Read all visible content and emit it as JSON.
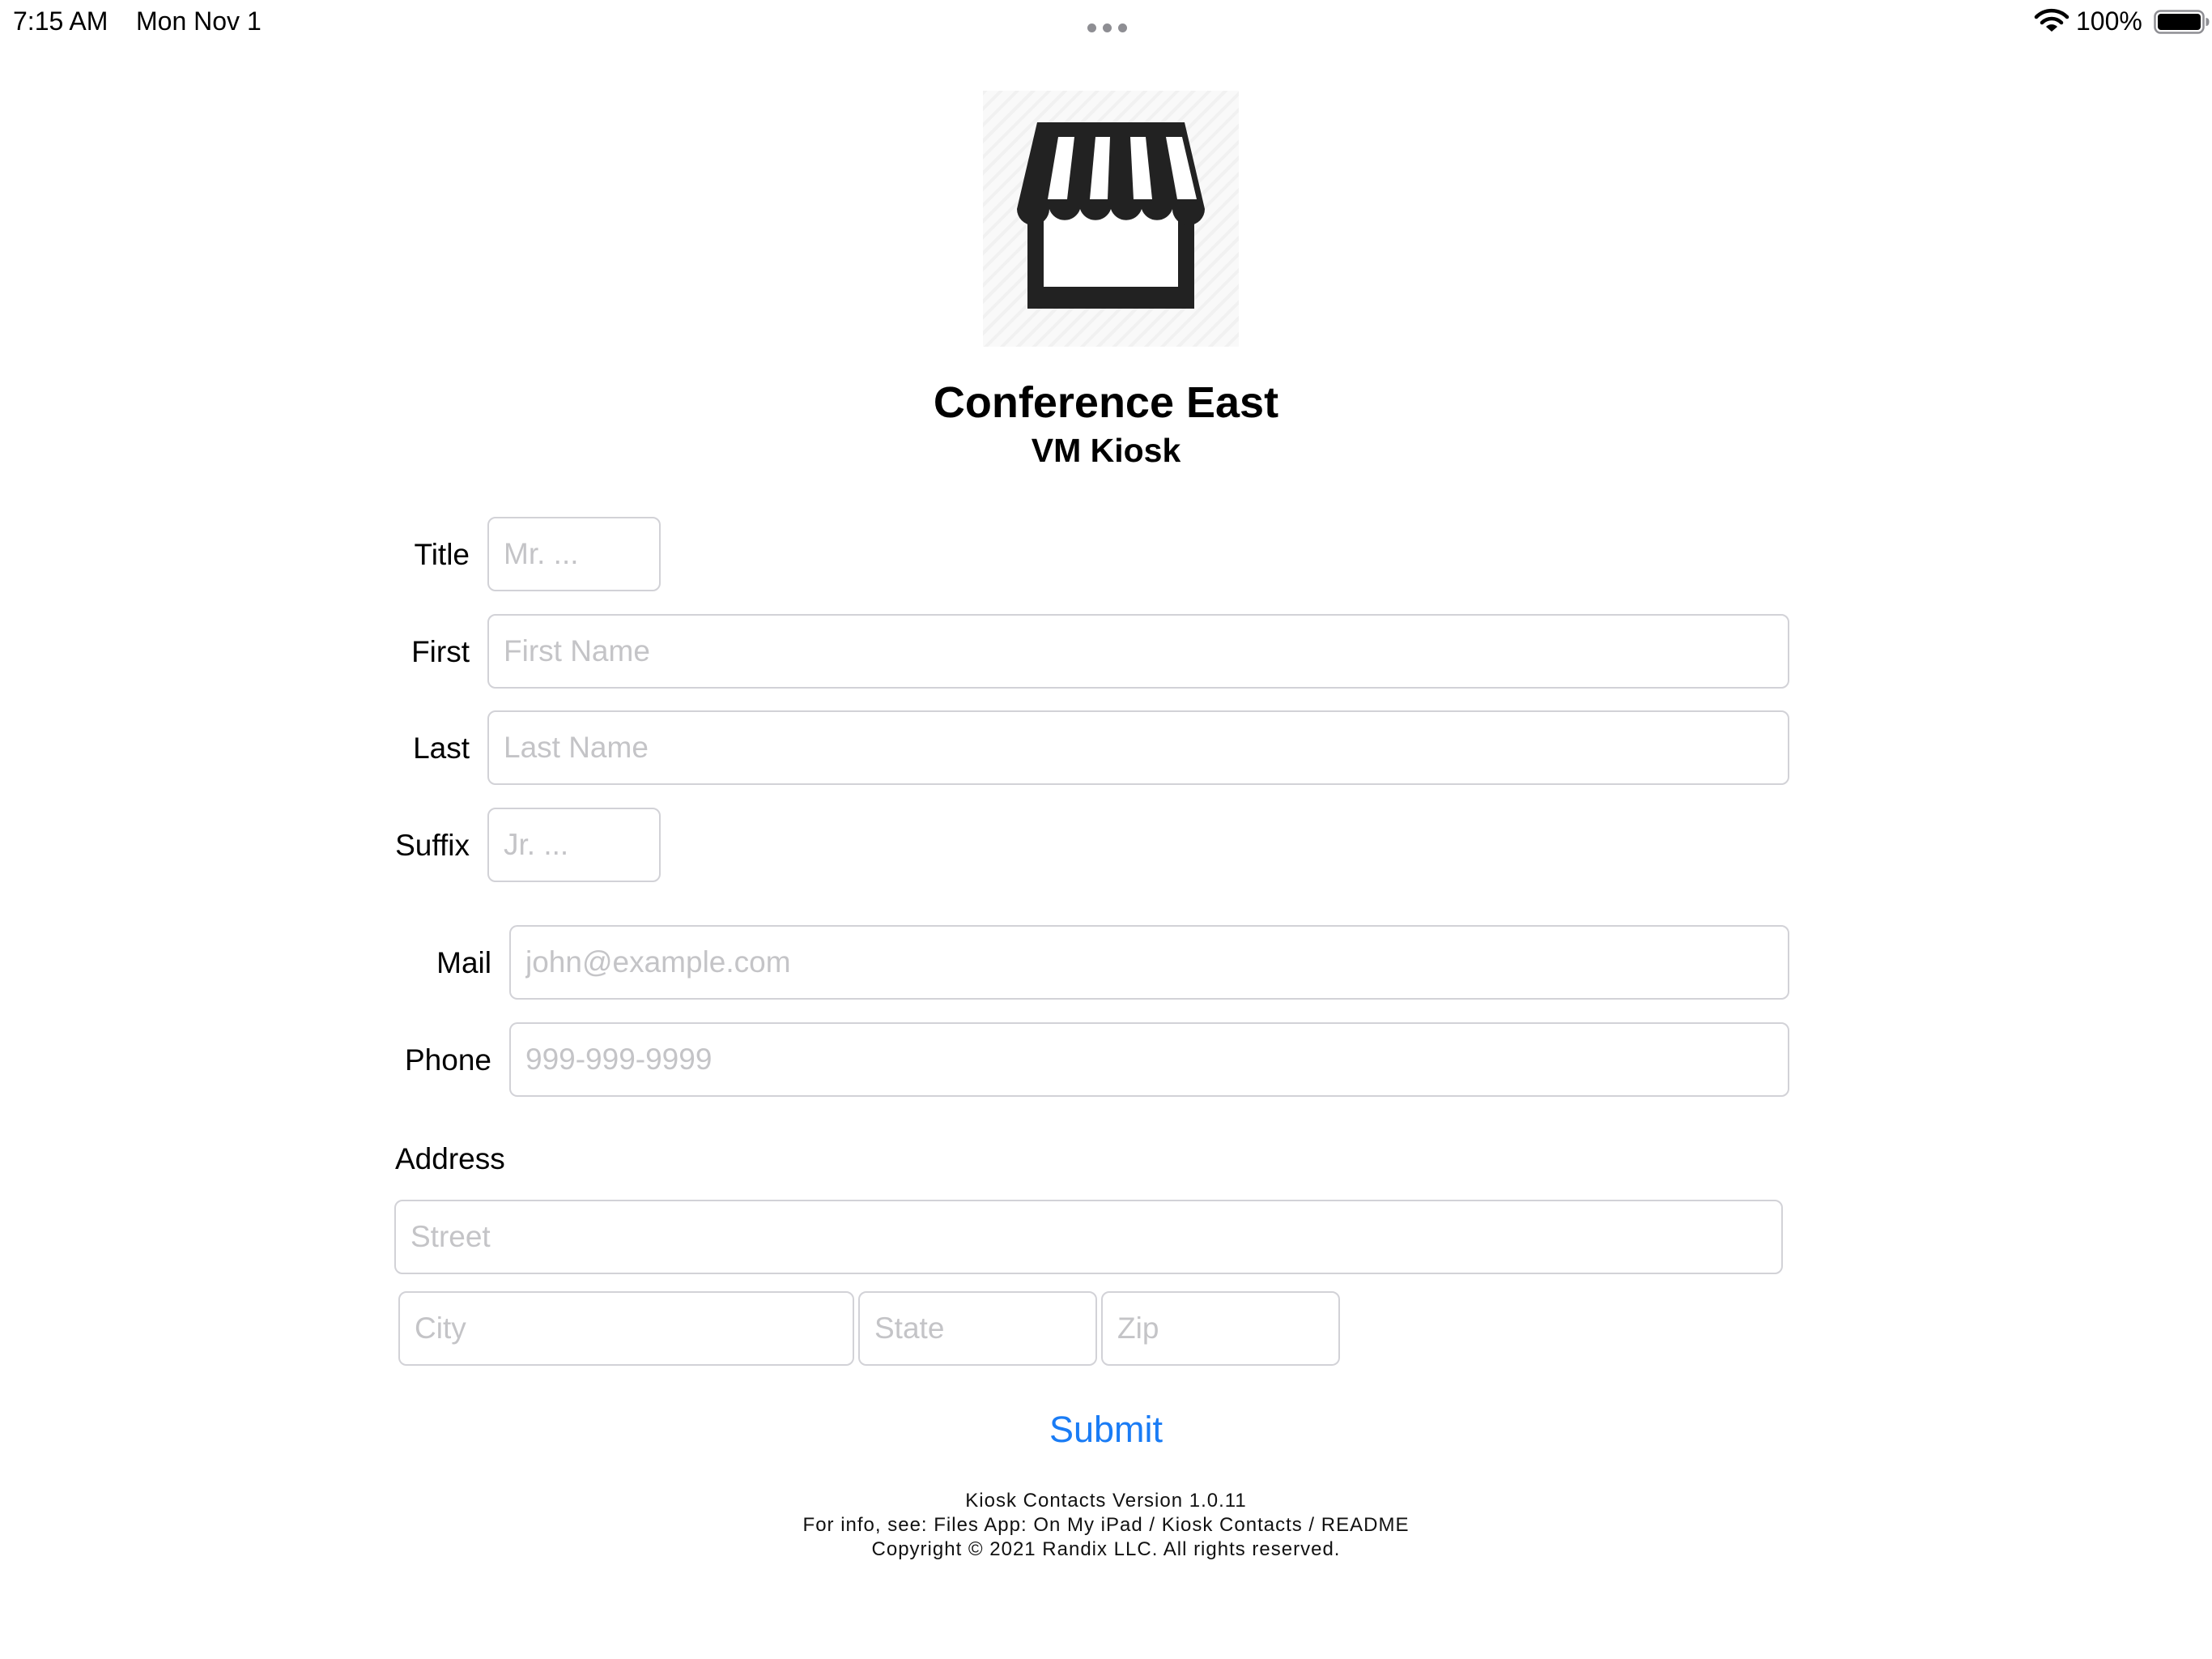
{
  "status_bar": {
    "time": "7:15 AM",
    "date": "Mon Nov 1",
    "battery_percent": "100%",
    "icons": [
      "multitasking-dots-icon",
      "wifi-icon",
      "battery-icon"
    ]
  },
  "header": {
    "logo_icon": "storefront-awning-icon",
    "title": "Conference East",
    "subtitle": "VM Kiosk"
  },
  "form": {
    "title": {
      "label": "Title",
      "placeholder": "Mr. ...",
      "value": ""
    },
    "first": {
      "label": "First",
      "placeholder": "First Name",
      "value": ""
    },
    "last": {
      "label": "Last",
      "placeholder": "Last Name",
      "value": ""
    },
    "suffix": {
      "label": "Suffix",
      "placeholder": "Jr. ...",
      "value": ""
    },
    "mail": {
      "label": "Mail",
      "placeholder": "john@example.com",
      "value": ""
    },
    "phone": {
      "label": "Phone",
      "placeholder": "999-999-9999",
      "value": ""
    },
    "address": {
      "label": "Address",
      "street": {
        "placeholder": "Street",
        "value": ""
      },
      "city": {
        "placeholder": "City",
        "value": ""
      },
      "state": {
        "placeholder": "State",
        "value": ""
      },
      "zip": {
        "placeholder": "Zip",
        "value": ""
      }
    },
    "submit_label": "Submit"
  },
  "footer": {
    "version": "Kiosk Contacts Version 1.0.11",
    "info": "For info, see: Files App: On My iPad / Kiosk Contacts / README",
    "copyright": "Copyright © 2021 Randix LLC. All rights reserved."
  },
  "colors": {
    "accent": "#1a7cf5",
    "input_border": "#d2d2d7",
    "placeholder": "#c4c4c7",
    "icon": "#222222"
  }
}
